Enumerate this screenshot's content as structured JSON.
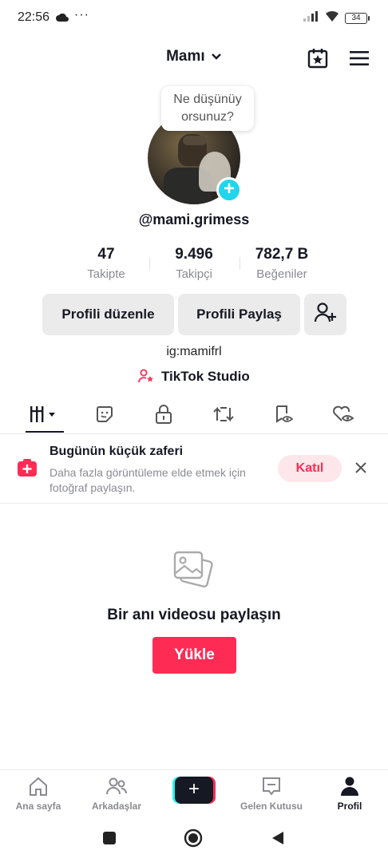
{
  "status_bar": {
    "time": "22:56",
    "dots": "···",
    "battery": "34"
  },
  "header": {
    "title": "Mamı"
  },
  "profile": {
    "bubble": "Ne düşünüy orsunuz?",
    "username": "@mami.grimess",
    "stats": [
      {
        "value": "47",
        "label": "Takipte"
      },
      {
        "value": "9.496",
        "label": "Takipçi"
      },
      {
        "value": "782,7 B",
        "label": "Beğeniler"
      }
    ],
    "edit_button": "Profili düzenle",
    "share_button": "Profili Paylaş",
    "bio": "ig:mamifrl",
    "studio_link": "TikTok Studio"
  },
  "tabs": [
    {
      "icon": "videos-grid-icon"
    },
    {
      "icon": "sticker-icon"
    },
    {
      "icon": "lock-icon"
    },
    {
      "icon": "repost-icon"
    },
    {
      "icon": "bookmark-eye-icon"
    },
    {
      "icon": "heart-eye-icon"
    }
  ],
  "banner": {
    "title": "Bugünün küçük zaferi",
    "subtitle": "Daha fazla görüntüleme elde etmek için fotoğraf paylaşın.",
    "join": "Katıl"
  },
  "empty_state": {
    "title": "Bir anı videosu paylaşın",
    "upload": "Yükle"
  },
  "bottom_nav": {
    "home": "Ana sayfa",
    "friends": "Arkadaşlar",
    "inbox": "Gelen Kutusu",
    "profile": "Profil"
  },
  "colors": {
    "accent": "#fe2c55",
    "cyan": "#20d5ec",
    "muted": "#8a8b91"
  }
}
